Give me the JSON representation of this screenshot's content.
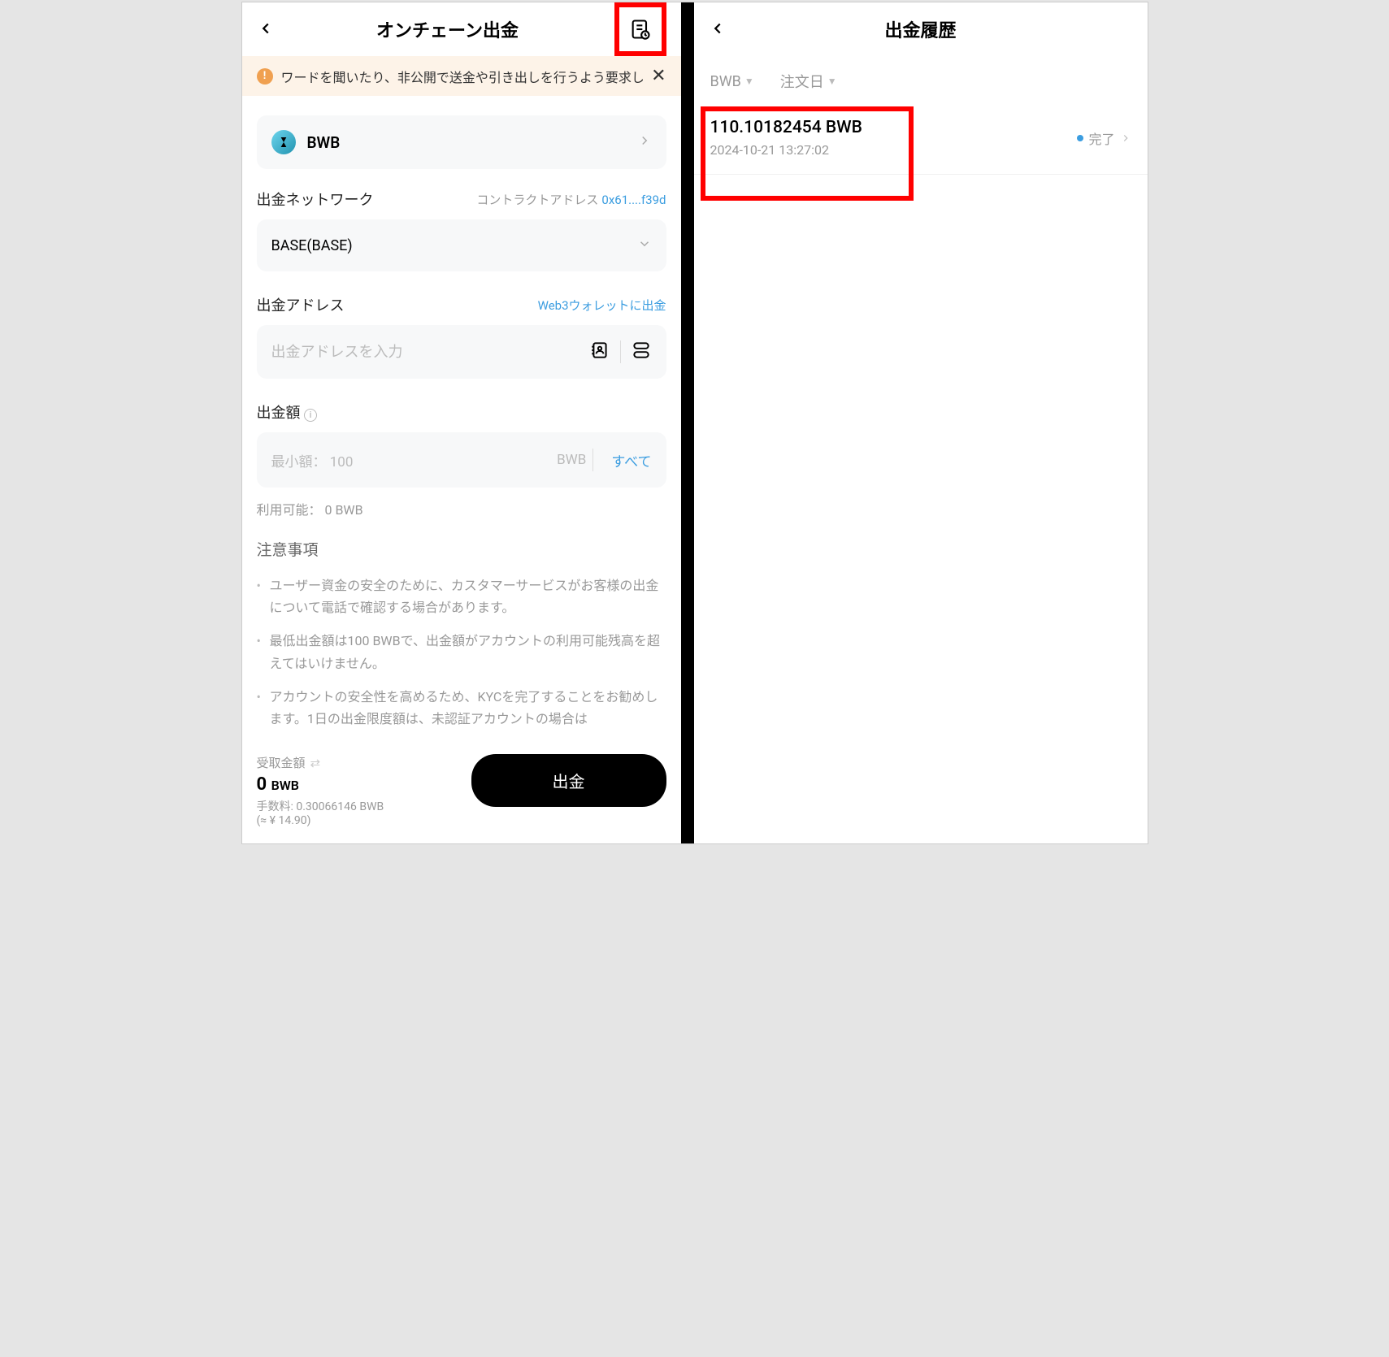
{
  "left": {
    "title": "オンチェーン出金",
    "warning": "ワードを聞いたり、非公開で送金や引き出しを行うよう要求し",
    "coin": {
      "symbol": "BWB"
    },
    "network": {
      "label": "出金ネットワーク",
      "contract_label": "コントラクトアドレス",
      "contract_addr": "0x61....f39d",
      "value": "BASE(BASE)"
    },
    "address": {
      "label": "出金アドレス",
      "link": "Web3ウォレットに出金",
      "placeholder": "出金アドレスを入力"
    },
    "amount": {
      "label": "出金額",
      "min_prefix": "最小額：",
      "min_value": "100",
      "unit": "BWB",
      "all_btn": "すべて",
      "available_label": "利用可能：",
      "available_value": "0 BWB"
    },
    "notice": {
      "title": "注意事項",
      "items": [
        "ユーザー資金の安全のために、カスタマーサービスがお客様の出金について電話で確認する場合があります。",
        "最低出金額は100 BWBで、出金額がアカウントの利用可能残高を超えてはいけません。",
        "アカウントの安全性を高めるため、KYCを完了することをお勧めします。1日の出金限度額は、未認証アカウントの場合は"
      ]
    },
    "footer": {
      "recv_label": "受取金額",
      "recv_amount": "0",
      "recv_unit": "BWB",
      "fee_label": "手数料:",
      "fee_value": "0.30066146 BWB",
      "fee_fiat": "(≈ ¥ 14.90)",
      "withdraw_btn": "出金"
    }
  },
  "right": {
    "title": "出金履歴",
    "filters": {
      "coin": "BWB",
      "date": "注文日"
    },
    "history": [
      {
        "amount": "110.10182454 BWB",
        "date": "2024-10-21 13:27:02",
        "status": "完了"
      }
    ]
  }
}
